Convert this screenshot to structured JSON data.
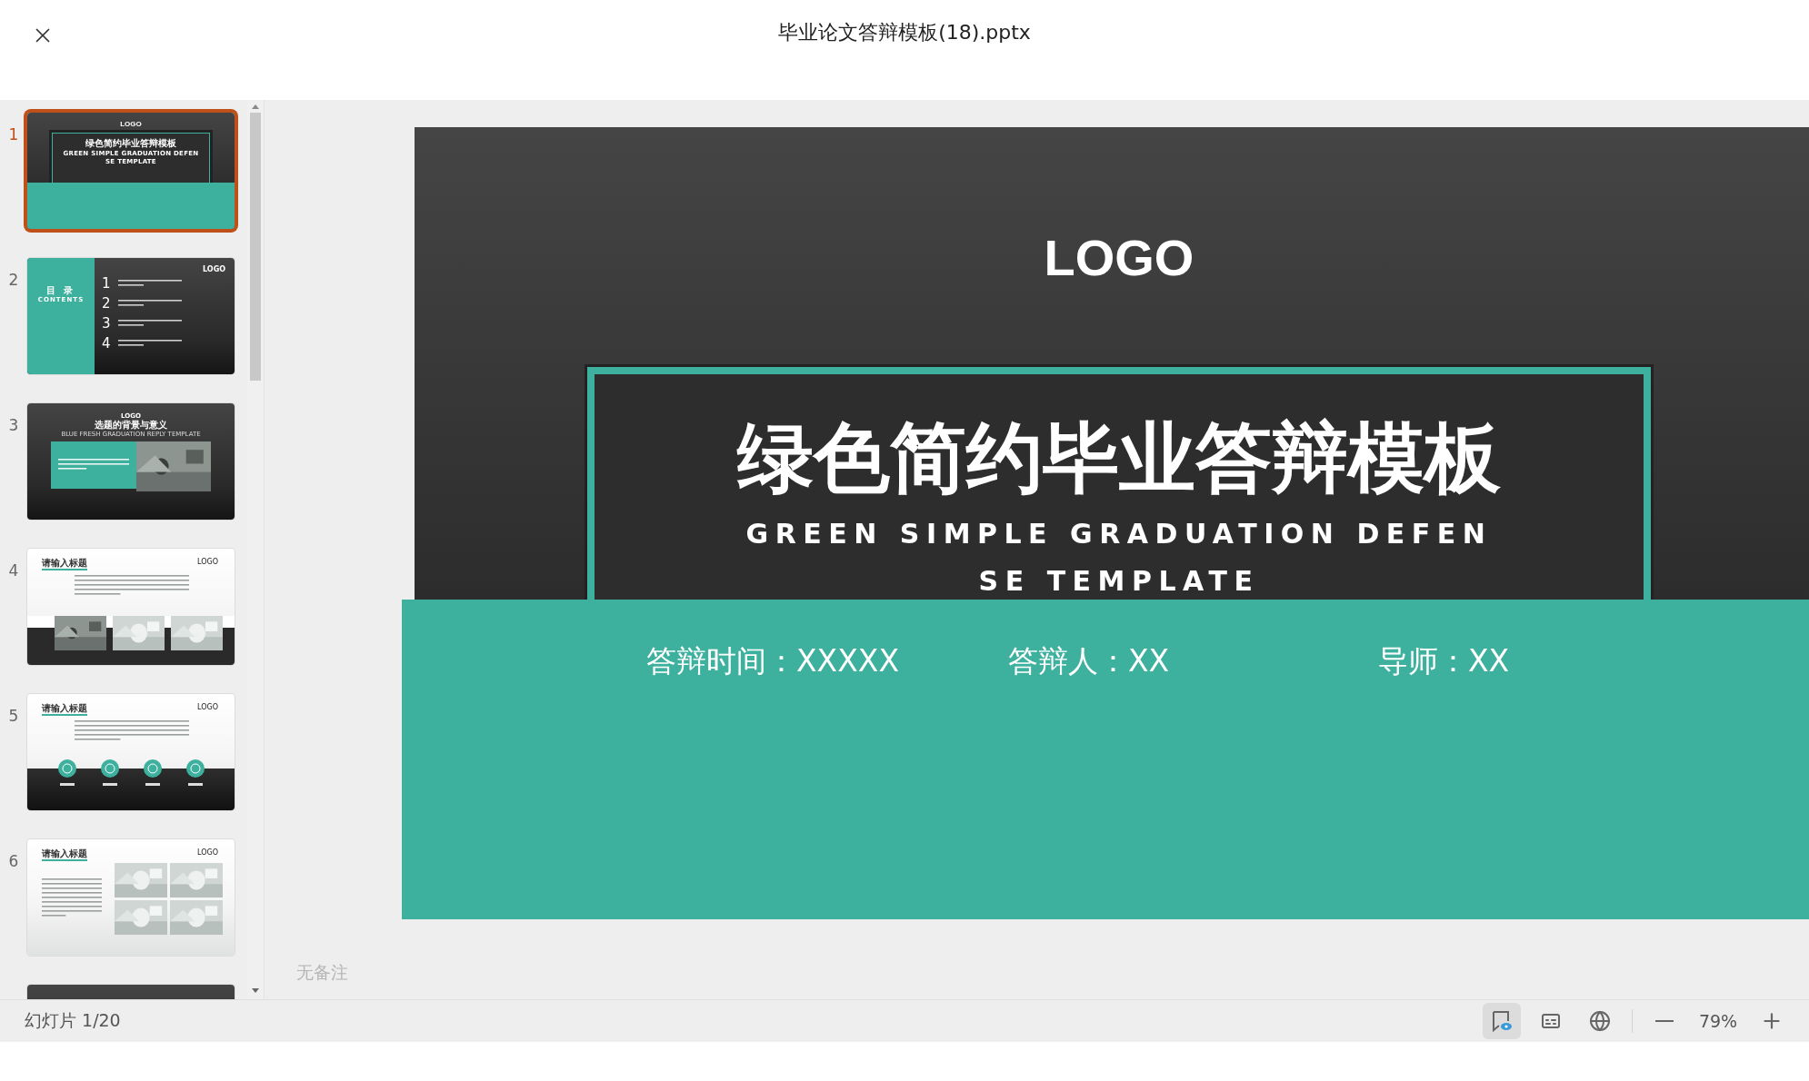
{
  "window": {
    "title": "毕业论文答辩模板(18).pptx"
  },
  "slides": [
    {
      "number": "1",
      "selected": true,
      "kind": "title",
      "logo": "LOGO",
      "title": "绿色简约毕业答辩模板",
      "subtitle_lines": [
        "GREEN SIMPLE GRADUATION DEFEN",
        "SE TEMPLATE"
      ]
    },
    {
      "number": "2",
      "selected": false,
      "kind": "contents",
      "logo": "LOGO",
      "heading": "目 录",
      "subheading": "CONTENTS",
      "items": [
        "1",
        "2",
        "3",
        "4"
      ]
    },
    {
      "number": "3",
      "selected": false,
      "kind": "section",
      "logo": "LOGO",
      "title": "选题的背景与意义",
      "subtitle": "BLUE FRESH GRADUATION REPLY TEMPLATE"
    },
    {
      "number": "4",
      "selected": false,
      "kind": "photos",
      "logo": "LOGO",
      "heading": "请输入标题"
    },
    {
      "number": "5",
      "selected": false,
      "kind": "icons",
      "logo": "LOGO",
      "heading": "请输入标题"
    },
    {
      "number": "6",
      "selected": false,
      "kind": "grid",
      "logo": "LOGO",
      "heading": "请输入标题"
    },
    {
      "selected": false,
      "kind": "partial"
    }
  ],
  "current_slide": {
    "logo": "LOGO",
    "title": "绿色简约毕业答辩模板",
    "subtitle_lines": [
      "GREEN SIMPLE GRADUATION DEFEN",
      "SE TEMPLATE"
    ],
    "details": [
      "答辩时间：XXXXX",
      "答辩人：XX",
      "导师：XX"
    ]
  },
  "notes": {
    "text": "无备注"
  },
  "status_bar": {
    "slide_counter": "幻灯片 1/20",
    "notes_view_on": true,
    "zoom": "79%"
  }
}
